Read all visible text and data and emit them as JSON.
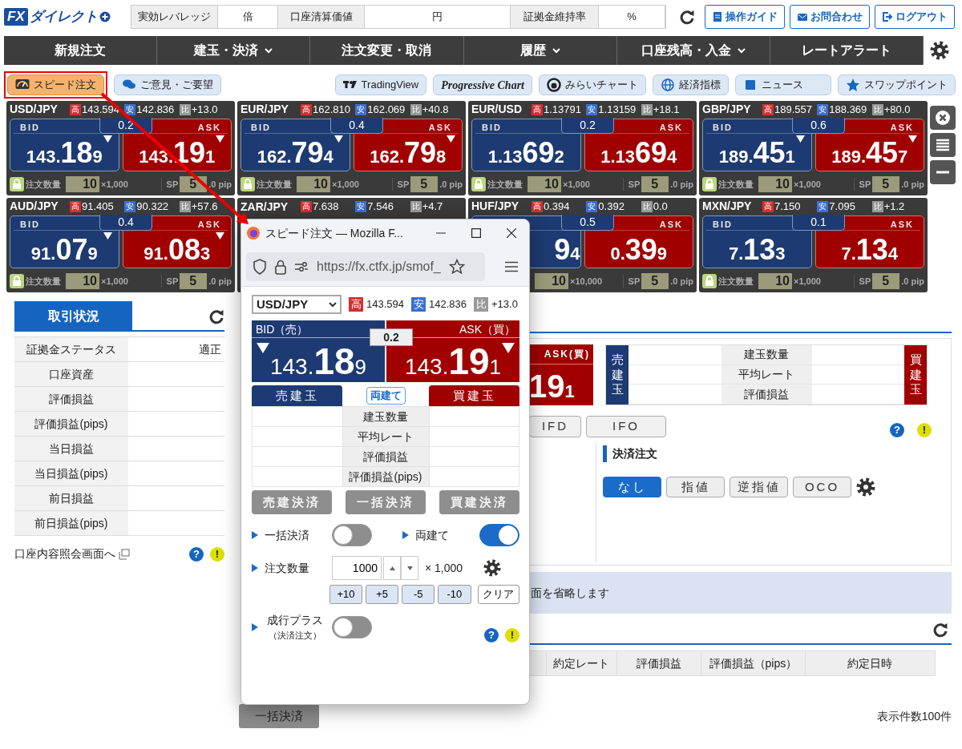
{
  "header": {
    "logo": {
      "mark": "FX",
      "name": "ダイレクト"
    },
    "stats": [
      {
        "label": "実効レバレッジ",
        "unit": "倍"
      },
      {
        "label": "口座清算価値",
        "unit": "円"
      },
      {
        "label": "証拠金維持率",
        "unit": "%"
      }
    ],
    "links": [
      {
        "label": "操作ガイド",
        "kind": "guide"
      },
      {
        "label": "お問合わせ",
        "kind": "mail"
      },
      {
        "label": "ログアウト",
        "kind": "logout"
      }
    ]
  },
  "nav": [
    {
      "label": "新規注文",
      "dropdown": false
    },
    {
      "label": "建玉・決済",
      "dropdown": true
    },
    {
      "label": "注文変更・取消",
      "dropdown": false
    },
    {
      "label": "履歴",
      "dropdown": true
    },
    {
      "label": "口座残高・入金",
      "dropdown": true
    },
    {
      "label": "レートアラート",
      "dropdown": false
    }
  ],
  "toolbar": {
    "left": [
      {
        "label": "スピード注文",
        "kind": "speed",
        "highlighted": true
      },
      {
        "label": "ご意見・ご要望",
        "kind": "chat",
        "highlighted": false
      }
    ],
    "right": [
      {
        "label": "TradingView",
        "kind": "tv"
      },
      {
        "label": "Progressive Chart",
        "kind": "plain"
      },
      {
        "label": "みらいチャート",
        "kind": "mirai"
      },
      {
        "label": "経済指標",
        "kind": "globe"
      },
      {
        "label": "ニュース",
        "kind": "news"
      },
      {
        "label": "スワップポイント",
        "kind": "star"
      }
    ]
  },
  "rates": [
    {
      "pair": "USD/JPY",
      "stats": [
        {
          "kind": "high",
          "label": "高",
          "value": "143.594"
        },
        {
          "kind": "low",
          "label": "安",
          "value": "142.836"
        },
        {
          "kind": "change",
          "label": "比",
          "value": "+13.0"
        }
      ],
      "spread": "0.2",
      "bid": {
        "label": "BID",
        "prefix": "143.",
        "big": "18",
        "small": "9",
        "falling": true
      },
      "ask": {
        "label": "ASK",
        "prefix": "143.",
        "big": "19",
        "small": "1",
        "falling": true
      },
      "qty_label": "注文数量",
      "qty": "10",
      "lot": "×1,000",
      "sp_label": "SP",
      "sp": "5",
      "sp_unit": ".0 pip"
    },
    {
      "pair": "EUR/JPY",
      "stats": [
        {
          "kind": "high",
          "label": "高",
          "value": "162.810"
        },
        {
          "kind": "low",
          "label": "安",
          "value": "162.069"
        },
        {
          "kind": "change",
          "label": "比",
          "value": "+40.8"
        }
      ],
      "spread": "0.4",
      "bid": {
        "label": "BID",
        "prefix": "162.",
        "big": "79",
        "small": "4",
        "falling": true
      },
      "ask": {
        "label": "ASK",
        "prefix": "162.",
        "big": "79",
        "small": "8",
        "falling": true
      },
      "qty_label": "注文数量",
      "qty": "10",
      "lot": "×1,000",
      "sp_label": "SP",
      "sp": "5",
      "sp_unit": ".0 pip"
    },
    {
      "pair": "EUR/USD",
      "stats": [
        {
          "kind": "high",
          "label": "高",
          "value": "1.13791"
        },
        {
          "kind": "low",
          "label": "安",
          "value": "1.13159"
        },
        {
          "kind": "change",
          "label": "比",
          "value": "+18.1"
        }
      ],
      "spread": "0.2",
      "bid": {
        "label": "BID",
        "prefix": "1.13",
        "big": "69",
        "small": "2",
        "falling": false
      },
      "ask": {
        "label": "ASK",
        "prefix": "1.13",
        "big": "69",
        "small": "4",
        "falling": false
      },
      "qty_label": "注文数量",
      "qty": "10",
      "lot": "×1,000",
      "sp_label": "SP",
      "sp": "5",
      "sp_unit": ".0 pip"
    },
    {
      "pair": "GBP/JPY",
      "stats": [
        {
          "kind": "high",
          "label": "高",
          "value": "189.557"
        },
        {
          "kind": "low",
          "label": "安",
          "value": "188.369"
        },
        {
          "kind": "change",
          "label": "比",
          "value": "+80.0"
        }
      ],
      "spread": "0.6",
      "bid": {
        "label": "BID",
        "prefix": "189.",
        "big": "45",
        "small": "1",
        "falling": true
      },
      "ask": {
        "label": "ASK",
        "prefix": "189.",
        "big": "45",
        "small": "7",
        "falling": true
      },
      "qty_label": "注文数量",
      "qty": "10",
      "lot": "×1,000",
      "sp_label": "SP",
      "sp": "5",
      "sp_unit": ".0 pip"
    },
    {
      "pair": "AUD/JPY",
      "stats": [
        {
          "kind": "high",
          "label": "高",
          "value": "91.405"
        },
        {
          "kind": "low",
          "label": "安",
          "value": "90.322"
        },
        {
          "kind": "change",
          "label": "比",
          "value": "+57.6"
        }
      ],
      "spread": "0.4",
      "bid": {
        "label": "BID",
        "prefix": "91.",
        "big": "07",
        "small": "9",
        "falling": true
      },
      "ask": {
        "label": "ASK",
        "prefix": "91.",
        "big": "08",
        "small": "3",
        "falling": true
      },
      "qty_label": "注文数量",
      "qty": "10",
      "lot": "×1,000",
      "sp_label": "SP",
      "sp": "5",
      "sp_unit": ".0 pip"
    },
    {
      "pair": "ZAR/JPY",
      "stats": [
        {
          "kind": "high",
          "label": "高",
          "value": "7.638"
        },
        {
          "kind": "low",
          "label": "安",
          "value": "7.546"
        },
        {
          "kind": "change",
          "label": "比",
          "value": "+4.7"
        }
      ]
    },
    {
      "pair": "HUF/JPY",
      "stats": [
        {
          "kind": "high",
          "label": "高",
          "value": "0.394"
        },
        {
          "kind": "low",
          "label": "安",
          "value": "0.392"
        },
        {
          "kind": "change",
          "label": "比",
          "value": "0.0"
        }
      ],
      "spread": "0.5",
      "bid": {
        "big": "9",
        "small": "4",
        "falling": false
      },
      "ask": {
        "label": "ASK",
        "prefix": "0.",
        "big": "39",
        "small": "9",
        "falling": false
      },
      "qty": "10",
      "lot": "×10,000",
      "sp_label": "SP",
      "sp": "5",
      "sp_unit": ".0 pip"
    },
    {
      "pair": "MXN/JPY",
      "stats": [
        {
          "kind": "high",
          "label": "高",
          "value": "7.150"
        },
        {
          "kind": "low",
          "label": "安",
          "value": "7.095"
        },
        {
          "kind": "change",
          "label": "比",
          "value": "+1.2"
        }
      ],
      "spread": "0.1",
      "bid": {
        "label": "BID",
        "prefix": "7.",
        "big": "13",
        "small": "3",
        "falling": false
      },
      "ask": {
        "label": "ASK",
        "prefix": "7.",
        "big": "13",
        "small": "4",
        "falling": false
      },
      "qty_label": "注文数量",
      "qty": "10",
      "lot": "×1,000",
      "sp_label": "SP",
      "sp": "5",
      "sp_unit": ".0 pip"
    }
  ],
  "side_buttons": [
    {
      "kind": "close"
    },
    {
      "kind": "list"
    },
    {
      "kind": "minimize"
    }
  ],
  "status_panel": {
    "tab": "取引状況",
    "rows": [
      {
        "label": "証拠金ステータス",
        "value": "適正"
      },
      {
        "label": "口座資産"
      },
      {
        "label": "評価損益"
      },
      {
        "label": "評価損益(pips)"
      },
      {
        "label": "当日損益"
      },
      {
        "label": "当日損益(pips)"
      },
      {
        "label": "前日損益"
      },
      {
        "label": "前日損益(pips)"
      }
    ],
    "link": "口座内容照会画面へ",
    "help": [
      "?",
      "!"
    ]
  },
  "order_panel": {
    "ask_header": "ASK(買)",
    "ask_big": "19",
    "ask_small": "1",
    "sell_label": "売建玉",
    "rows": [
      "建玉数量",
      "平均レート",
      "評価損益"
    ],
    "buy_label": "買建玉",
    "order_types": [
      "IFD",
      "IFO"
    ],
    "help": [
      "?",
      "!"
    ],
    "settle_title": "決済注文",
    "settle_types": [
      {
        "label": "なし",
        "selected": true
      },
      {
        "label": "指値",
        "selected": false
      },
      {
        "label": "逆指値",
        "selected": false
      },
      {
        "label": "OCO",
        "selected": false
      }
    ],
    "notice": "面を省略します",
    "history_columns": [
      "約定レート",
      "評価損益",
      "評価損益（pips）",
      "約定日時"
    ],
    "count": "表示件数100件",
    "bulk_button": "一括決済"
  },
  "popup": {
    "title": "スピード注文 — Mozilla F...",
    "url": "https://fx.ctfx.jp/smof_",
    "pair": "USD/JPY",
    "stats": [
      {
        "kind": "high",
        "label": "高",
        "value": "143.594"
      },
      {
        "kind": "low",
        "label": "安",
        "value": "142.836"
      },
      {
        "kind": "change",
        "label": "比",
        "value": "+13.0"
      }
    ],
    "bid_header": "BID（売）",
    "ask_header": "ASK（買）",
    "spread": "0.2",
    "bid": {
      "prefix": "143.",
      "big": "18",
      "small": "9",
      "falling": true
    },
    "ask": {
      "prefix": "143.",
      "big": "19",
      "small": "1",
      "falling": true
    },
    "sell_pos": "売建玉",
    "hedge_badge": "両建て",
    "buy_pos": "買建玉",
    "rows": [
      "建玉数量",
      "平均レート",
      "評価損益",
      "評価損益(pips)"
    ],
    "close_buttons": [
      "売建決済",
      "一括決済",
      "買建決済"
    ],
    "toggles": [
      {
        "label": "一括決済",
        "on": false
      },
      {
        "label": "両建て",
        "on": true
      }
    ],
    "qty_label": "注文数量",
    "qty": "1000",
    "multiplier": "× 1,000",
    "steps": [
      "+10",
      "+5",
      "-5",
      "-10"
    ],
    "clear": "クリア",
    "market_plus": {
      "label": "成行プラス",
      "sub": "（決済注文）",
      "on": false
    },
    "help": [
      "?",
      "!"
    ]
  }
}
